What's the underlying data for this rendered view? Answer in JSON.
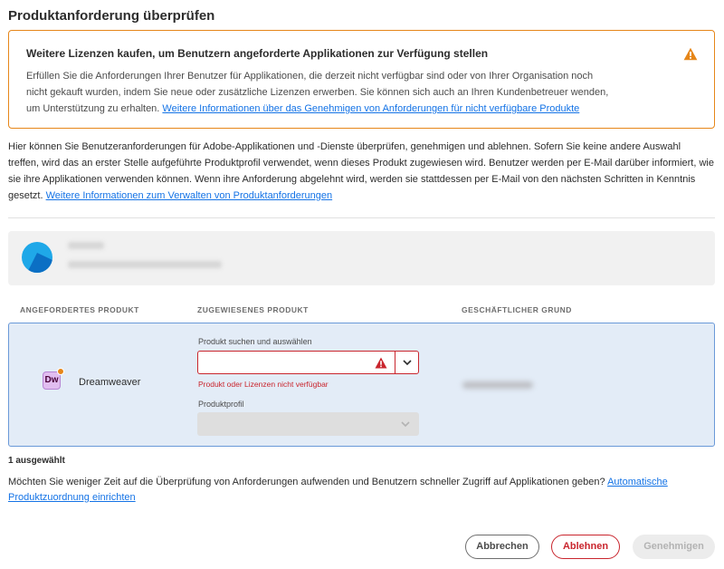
{
  "page": {
    "title": "Produktanforderung überprüfen"
  },
  "alert": {
    "heading": "Weitere Lizenzen kaufen, um Benutzern angeforderte Applikationen zur Verfügung stellen",
    "body": "Erfüllen Sie die Anforderungen Ihrer Benutzer für Applikationen, die derzeit nicht verfügbar sind oder von Ihrer Organisation noch nicht gekauft wurden, indem Sie neue oder zusätzliche Lizenzen erwerben. Sie können sich auch an Ihren Kundenbetreuer wenden, um Unterstützung zu erhalten.",
    "link": "Weitere Informationen über das Genehmigen von Anforderungen für nicht verfügbare Produkte",
    "icon": "warning-icon",
    "color": "#e68619"
  },
  "intro": {
    "text": "Hier können Sie Benutzeranforderungen für Adobe-Applikationen und -Dienste überprüfen, genehmigen und ablehnen. Sofern Sie keine andere Auswahl treffen, wird das an erster Stelle aufgeführte Produktprofil verwendet, wenn dieses Produkt zugewiesen wird. Benutzer werden per E-Mail darüber informiert, wie sie ihre Applikationen verwenden können. Wenn ihre Anforderung abgelehnt wird, werden sie stattdessen per E-Mail von den nächsten Schritten in Kenntnis gesetzt.",
    "link": "Weitere Informationen zum Verwalten von Produktanforderungen"
  },
  "table": {
    "headers": {
      "requested": "ANGEFORDERTES PRODUKT",
      "assigned": "ZUGEWIESENES PRODUKT",
      "reason": "GESCHÄFTLICHER GRUND"
    },
    "row": {
      "product_name": "Dreamweaver",
      "product_icon_text": "Dw",
      "picker_label": "Produkt suchen und auswählen",
      "picker_value": "",
      "picker_error": "Produkt oder Lizenzen nicht verfügbar",
      "profile_label": "Produktprofil",
      "profile_value": ""
    }
  },
  "selection": {
    "count_label": "1 ausgewählt"
  },
  "auto_assign": {
    "text": "Möchten Sie weniger Zeit auf die Überprüfung von Anforderungen aufwenden und Benutzern schneller Zugriff auf Applikationen geben?",
    "link": "Automatische Produktzuordnung einrichten"
  },
  "buttons": {
    "cancel": "Abbrechen",
    "reject": "Ablehnen",
    "approve": "Genehmigen"
  },
  "colors": {
    "accent": "#1473e6",
    "error": "#c9252d",
    "warning": "#e68619",
    "selected_row": "#e3ecf7"
  }
}
